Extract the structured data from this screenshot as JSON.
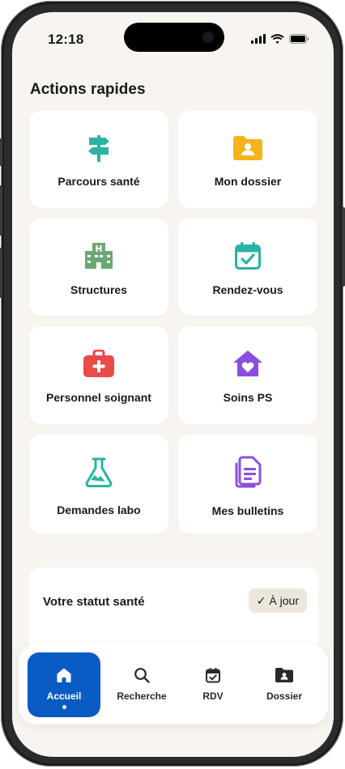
{
  "status_bar": {
    "time": "12:18"
  },
  "quick_actions": {
    "title": "Actions rapides",
    "items": [
      {
        "label": "Parcours santé",
        "icon": "signpost-icon",
        "color": "#2ab3a4"
      },
      {
        "label": "Mon dossier",
        "icon": "folder-user-icon",
        "color": "#f5b41b"
      },
      {
        "label": "Structures",
        "icon": "hospital-building-icon",
        "color": "#6aa874"
      },
      {
        "label": "Rendez-vous",
        "icon": "calendar-check-icon",
        "color": "#2ab3a4"
      },
      {
        "label": "Personnel soignant",
        "icon": "medical-bag-icon",
        "color": "#ea4a4a"
      },
      {
        "label": "Soins PS",
        "icon": "home-heart-icon",
        "color": "#8b4fe0"
      },
      {
        "label": "Demandes labo",
        "icon": "flask-icon",
        "color": "#2ab3a4"
      },
      {
        "label": "Mes bulletins",
        "icon": "documents-icon",
        "color": "#8b4fe0"
      }
    ]
  },
  "health_status": {
    "title": "Votre statut santé",
    "badge": "✓ À jour"
  },
  "nav": {
    "items": [
      {
        "label": "Accueil",
        "icon": "home-icon",
        "active": true
      },
      {
        "label": "Recherche",
        "icon": "search-icon",
        "active": false
      },
      {
        "label": "RDV",
        "icon": "calendar-icon",
        "active": false
      },
      {
        "label": "Dossier",
        "icon": "folder-icon",
        "active": false
      }
    ],
    "active_color": "#0a5bc4"
  }
}
